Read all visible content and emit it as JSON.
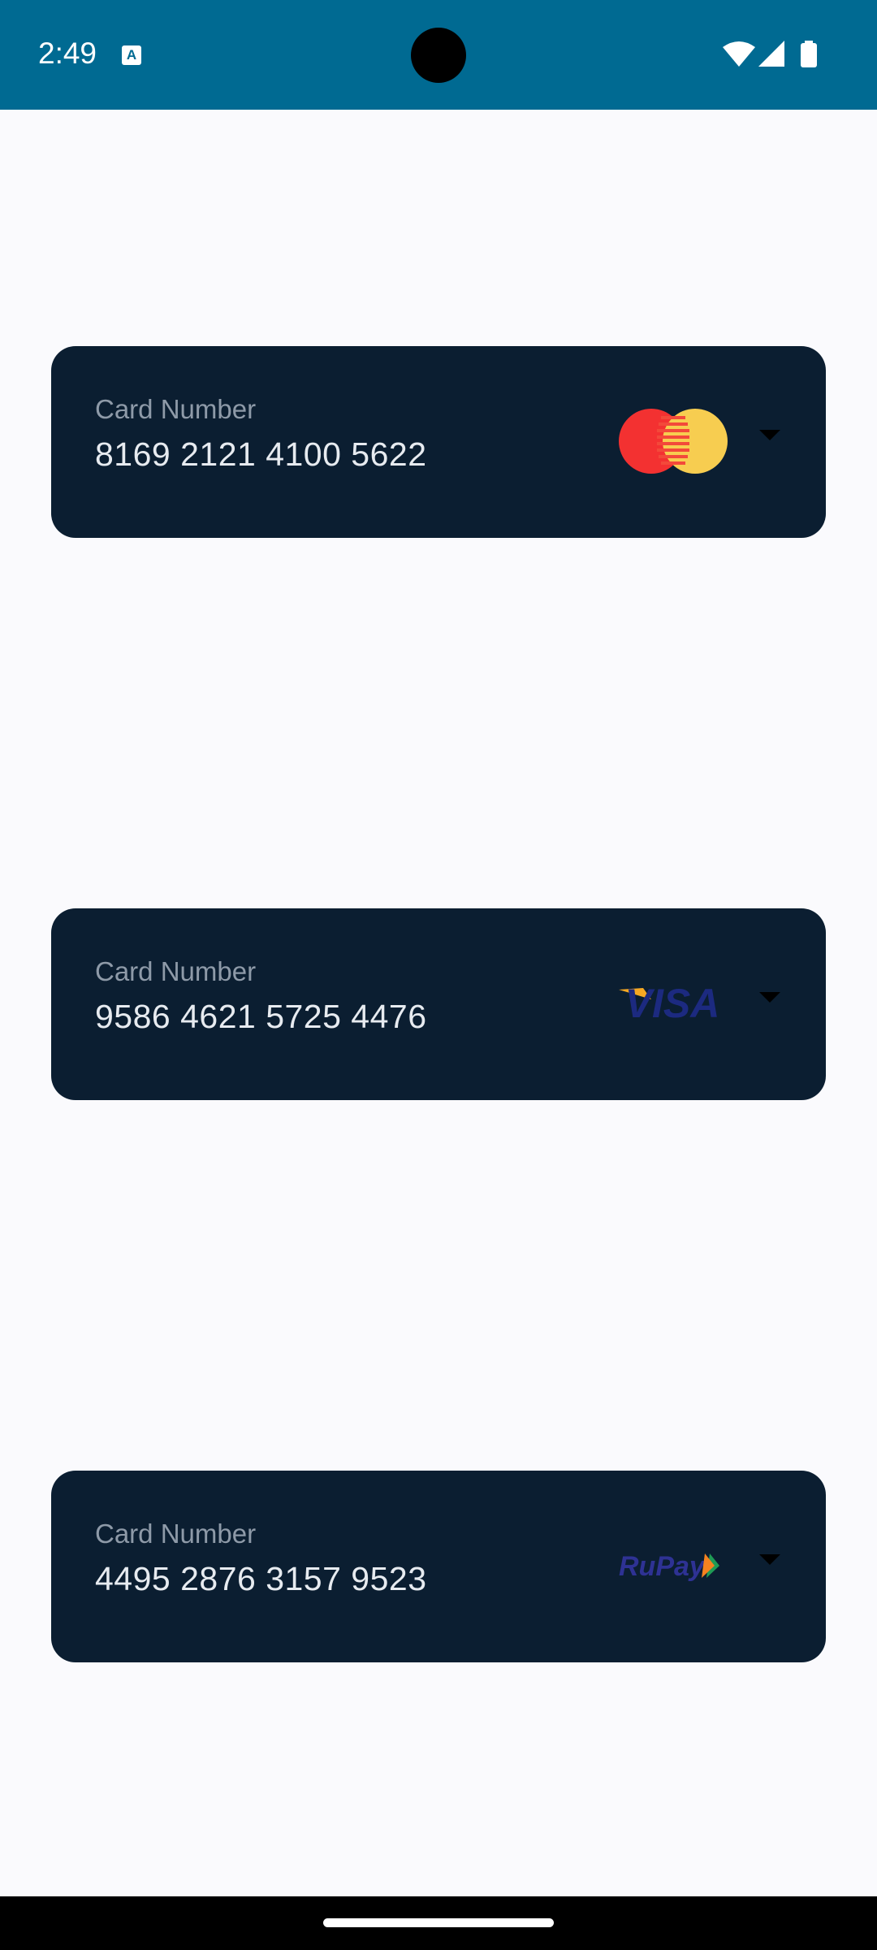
{
  "status_bar": {
    "time": "2:49",
    "notification_icon": "keyboard-a-icon",
    "wifi_icon": "wifi-icon",
    "signal_icon": "cell-signal-icon",
    "battery_icon": "battery-icon",
    "color": "#006a92"
  },
  "cards": [
    {
      "label": "Card Number",
      "number": "8169 2121 4100 5622",
      "brand": "mastercard",
      "dropdown_icon": "chevron-down-icon"
    },
    {
      "label": "Card Number",
      "number": "9586 4621 5725 4476",
      "brand": "visa",
      "brand_text": "VISA",
      "dropdown_icon": "chevron-down-icon"
    },
    {
      "label": "Card Number",
      "number": "4495 2876 3157 9523",
      "brand": "rupay",
      "brand_text": "RuPay",
      "dropdown_icon": "chevron-down-icon"
    }
  ],
  "colors": {
    "background": "#fafafd",
    "card_background": "#0b1e31",
    "label": "#8e9aa8",
    "number": "#e7ebf0"
  }
}
